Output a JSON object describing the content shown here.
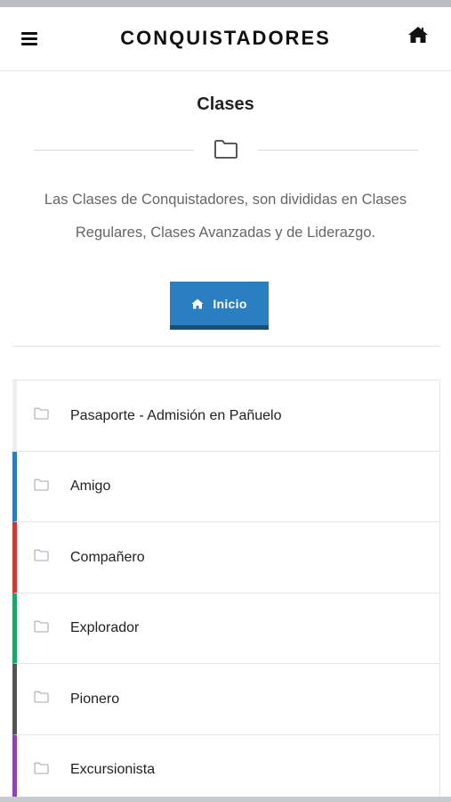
{
  "status_bar": {
    "battery_color": "#3ddc4a"
  },
  "header": {
    "title": "CONQUISTADORES",
    "menu_icon": "hamburger-menu-icon",
    "home_icon": "home-icon"
  },
  "section": {
    "title": "Clases",
    "divider_icon": "folder-icon",
    "description": "Las Clases de Conquistadores, son divididas en Clases Regulares, Clases Avanzadas y de Liderazgo.",
    "button": {
      "label": "Inicio",
      "icon": "home-icon",
      "color": "#2a7fc0"
    }
  },
  "classes": [
    {
      "label": "Pasaporte - Admisión en Pañuelo",
      "accent": "#eeeeee",
      "icon": "folder-icon"
    },
    {
      "label": "Amigo",
      "accent": "#2e7bbf",
      "icon": "folder-icon"
    },
    {
      "label": "Compañero",
      "accent": "#cc3a35",
      "icon": "folder-icon"
    },
    {
      "label": "Explorador",
      "accent": "#23a36a",
      "icon": "folder-icon"
    },
    {
      "label": "Pionero",
      "accent": "#555555",
      "icon": "folder-icon"
    },
    {
      "label": "Excursionista",
      "accent": "#8e44ad",
      "icon": "folder-icon"
    }
  ]
}
